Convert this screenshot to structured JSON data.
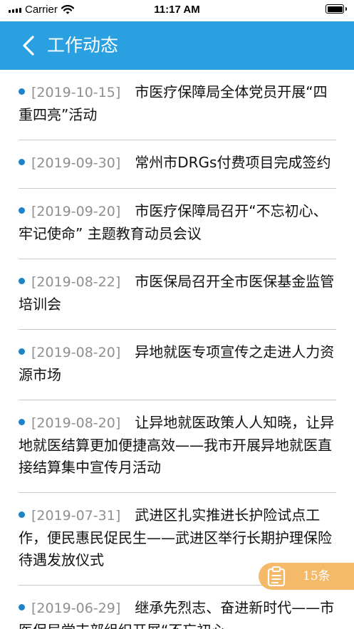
{
  "status_bar": {
    "carrier": "Carrier",
    "time": "11:17 AM"
  },
  "header": {
    "title": "工作动态"
  },
  "news": [
    {
      "date": "[2019-10-15]",
      "title": "市医疗保障局全体党员开展“四重四亮”活动"
    },
    {
      "date": "[2019-09-30]",
      "title": "常州市DRGs付费项目完成签约"
    },
    {
      "date": "[2019-09-20]",
      "title": "市医疗保障局召开“不忘初心、牢记使命” 主题教育动员会议"
    },
    {
      "date": "[2019-08-22]",
      "title": "市医保局召开全市医保基金监管培训会"
    },
    {
      "date": "[2019-08-20]",
      "title": "异地就医专项宣传之走进人力资源市场"
    },
    {
      "date": "[2019-08-20]",
      "title": "让异地就医政策人人知晓，让异地就医结算更加便捷高效——我市开展异地就医直接结算集中宣传月活动"
    },
    {
      "date": "[2019-07-31]",
      "title": "武进区扎实推进长护险试点工作，便民惠民促民生——武进区举行长期护理保险待遇发放仪式"
    },
    {
      "date": "[2019-06-29]",
      "title": "继承先烈志、奋进新时代——市医保局党支部组织开展“不忘初心"
    }
  ],
  "counter": {
    "label": "15条"
  },
  "colors": {
    "header_bg": "#2aa0e0",
    "bullet": "#1e82c8",
    "date": "#8f8f8f",
    "counter_bg": "#f5b96a"
  },
  "icons": {
    "back": "chevron-left-icon",
    "counter": "clipboard-list-icon",
    "wifi": "wifi-icon",
    "battery": "battery-icon"
  }
}
